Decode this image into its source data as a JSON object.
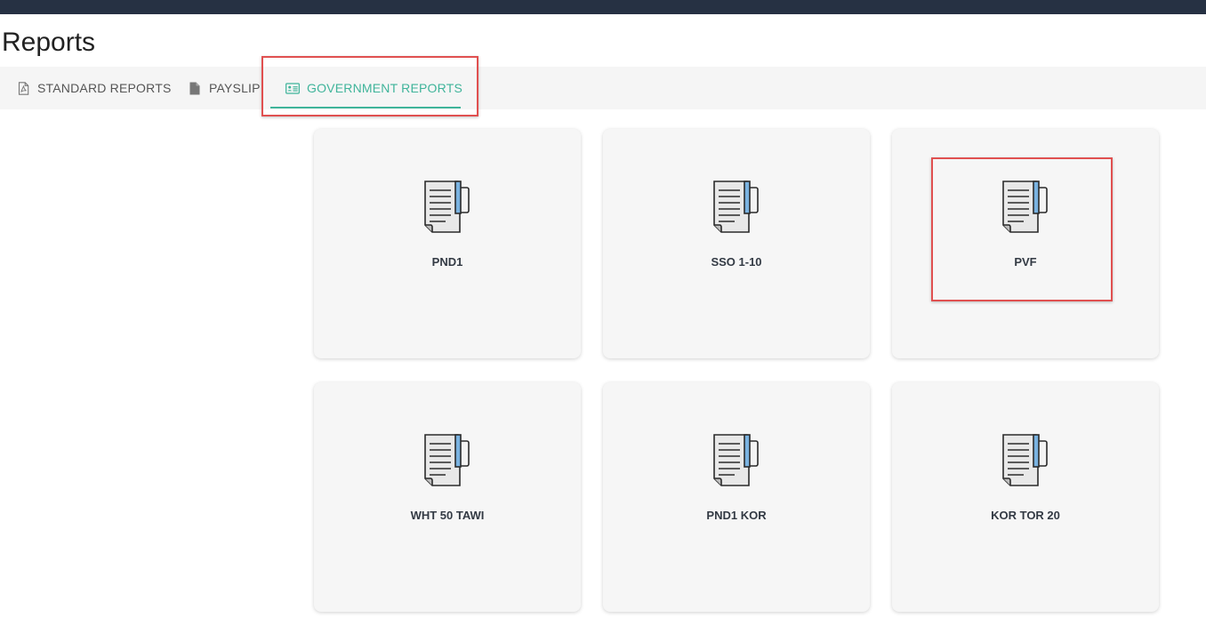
{
  "page": {
    "title": "Reports"
  },
  "tabs": [
    {
      "label": "STANDARD REPORTS",
      "icon": "pdf-file-icon",
      "active": false
    },
    {
      "label": "PAYSLIP",
      "icon": "file-icon",
      "active": false
    },
    {
      "label": "GOVERNMENT REPORTS",
      "icon": "id-card-icon",
      "active": true
    }
  ],
  "cards": [
    {
      "label": "PND1",
      "icon": "document-icon"
    },
    {
      "label": "SSO 1-10",
      "icon": "document-icon"
    },
    {
      "label": "PVF",
      "icon": "document-icon"
    },
    {
      "label": "WHT 50 TAWI",
      "icon": "document-icon"
    },
    {
      "label": "PND1 KOR",
      "icon": "document-icon"
    },
    {
      "label": "KOR TOR 20",
      "icon": "document-icon"
    }
  ],
  "colors": {
    "topbar": "#263143",
    "accent": "#3fb49a",
    "highlight": "#e05050",
    "card_bg": "#f6f6f6"
  }
}
